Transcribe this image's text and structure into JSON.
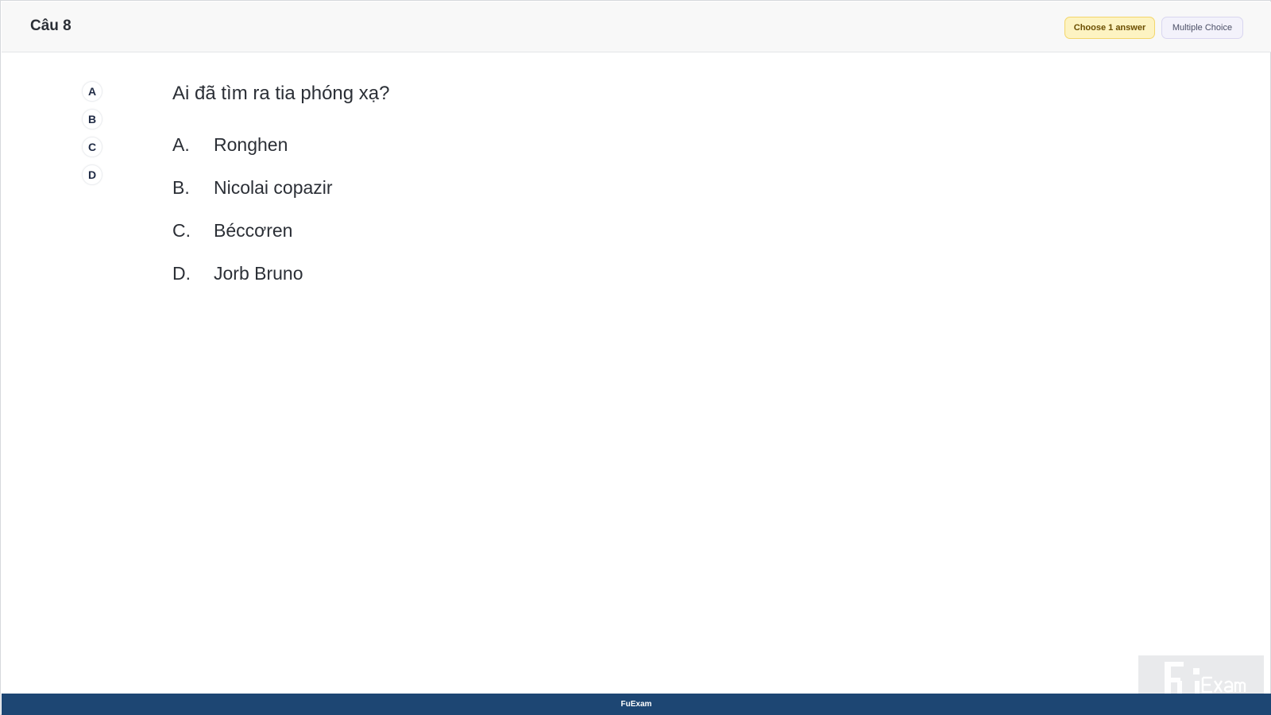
{
  "header": {
    "question_title": "Câu 8",
    "choose_badge": "Choose 1 answer",
    "type_badge": "Multiple Choice"
  },
  "answer_selector": {
    "letters": [
      "A",
      "B",
      "C",
      "D"
    ]
  },
  "question": {
    "text": "Ai đã tìm ra tia phóng xạ?",
    "options": [
      {
        "label": "A.",
        "text": "Ronghen"
      },
      {
        "label": "B.",
        "text": "Nicolai copazir"
      },
      {
        "label": "C.",
        "text": "Béccơren"
      },
      {
        "label": "D.",
        "text": "Jorb Bruno"
      }
    ]
  },
  "watermark": {
    "logo_text": "FUExam"
  },
  "footer": {
    "brand": "FuExam"
  },
  "colors": {
    "header_bg": "#f8f8f8",
    "footer_bg": "#1d4673",
    "choose_badge_bg": "#fdf3c2",
    "type_badge_bg": "#f3f2fb"
  }
}
